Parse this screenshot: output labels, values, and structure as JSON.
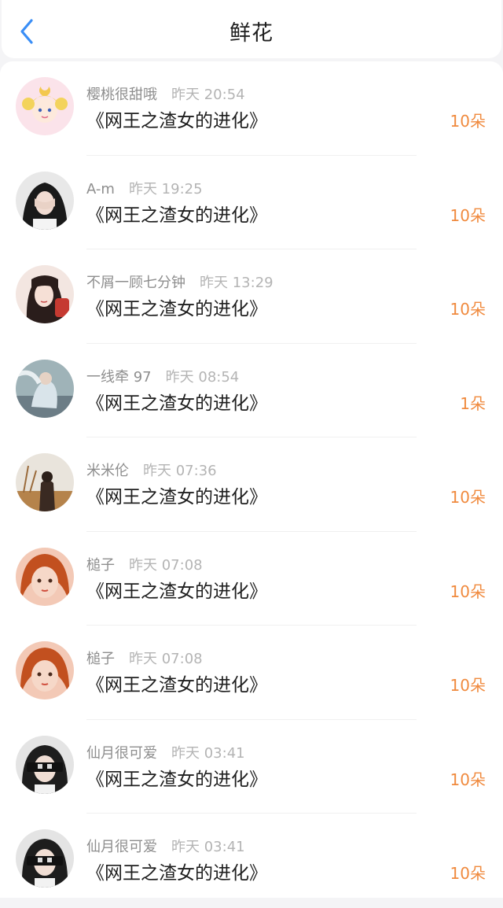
{
  "header": {
    "title": "鲜花",
    "back_icon": "chevron-left-icon"
  },
  "colors": {
    "accent_blue": "#3a8ef6",
    "amount_orange": "#f08a3e"
  },
  "items": [
    {
      "username": "樱桃很甜哦",
      "time": "昨天 20:54",
      "book": "《网王之渣女的进化》",
      "amount": "10朵"
    },
    {
      "username": "A-m",
      "time": "昨天 19:25",
      "book": "《网王之渣女的进化》",
      "amount": "10朵"
    },
    {
      "username": "不屑一顾七分钟",
      "time": "昨天 13:29",
      "book": "《网王之渣女的进化》",
      "amount": "10朵"
    },
    {
      "username": "一线牵 97",
      "time": "昨天 08:54",
      "book": "《网王之渣女的进化》",
      "amount": "1朵"
    },
    {
      "username": "米米伦",
      "time": "昨天 07:36",
      "book": "《网王之渣女的进化》",
      "amount": "10朵"
    },
    {
      "username": "槌子",
      "time": "昨天 07:08",
      "book": "《网王之渣女的进化》",
      "amount": "10朵"
    },
    {
      "username": "槌子",
      "time": "昨天 07:08",
      "book": "《网王之渣女的进化》",
      "amount": "10朵"
    },
    {
      "username": "仙月很可爱",
      "time": "昨天 03:41",
      "book": "《网王之渣女的进化》",
      "amount": "10朵"
    },
    {
      "username": "仙月很可爱",
      "time": "昨天 03:41",
      "book": "《网王之渣女的进化》",
      "amount": "10朵"
    }
  ]
}
